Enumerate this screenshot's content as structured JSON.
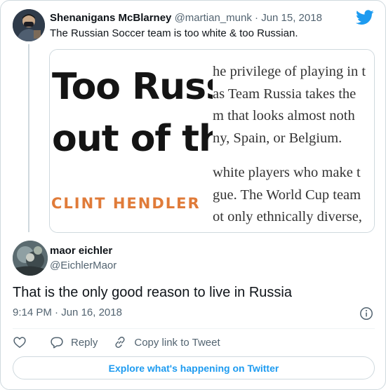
{
  "parent_tweet": {
    "display_name": "Shenanigans McBlarney",
    "handle": "@martian_munk",
    "separator": "·",
    "date": "Jun 15, 2018",
    "text": "The Russian Soccer team is too white & too Russian."
  },
  "quoted_card": {
    "cover_line_1": "Too Russ",
    "cover_line_2": "out of th",
    "cover_author": "CLINT HENDLER",
    "page_lines_top": [
      "he privilege of playing in t",
      "as Team Russia takes the",
      "m that looks almost noth",
      "ny, Spain, or Belgium."
    ],
    "page_lines_bottom": [
      "white players who make t",
      "gue. The World Cup team",
      "ot only ethnically diverse,"
    ]
  },
  "reply_tweet": {
    "display_name": "maor eichler",
    "handle": "@EichlerMaor",
    "text": "That is the only good reason to live in Russia",
    "time": "9:14 PM",
    "separator": "·",
    "date": "Jun 16, 2018"
  },
  "actions": {
    "reply_label": "Reply",
    "copy_link_label": "Copy link to Tweet"
  },
  "explore_label": "Explore what's happening on Twitter",
  "colors": {
    "accent": "#1d9bf0",
    "text_primary": "#0f1419",
    "text_secondary": "#536471",
    "border": "#cfd9de",
    "cover_author": "#e07b39"
  },
  "icons": {
    "brand": "twitter-bird-icon",
    "info": "info-icon",
    "like": "heart-icon",
    "reply": "reply-bubble-icon",
    "copy_link": "link-icon"
  }
}
